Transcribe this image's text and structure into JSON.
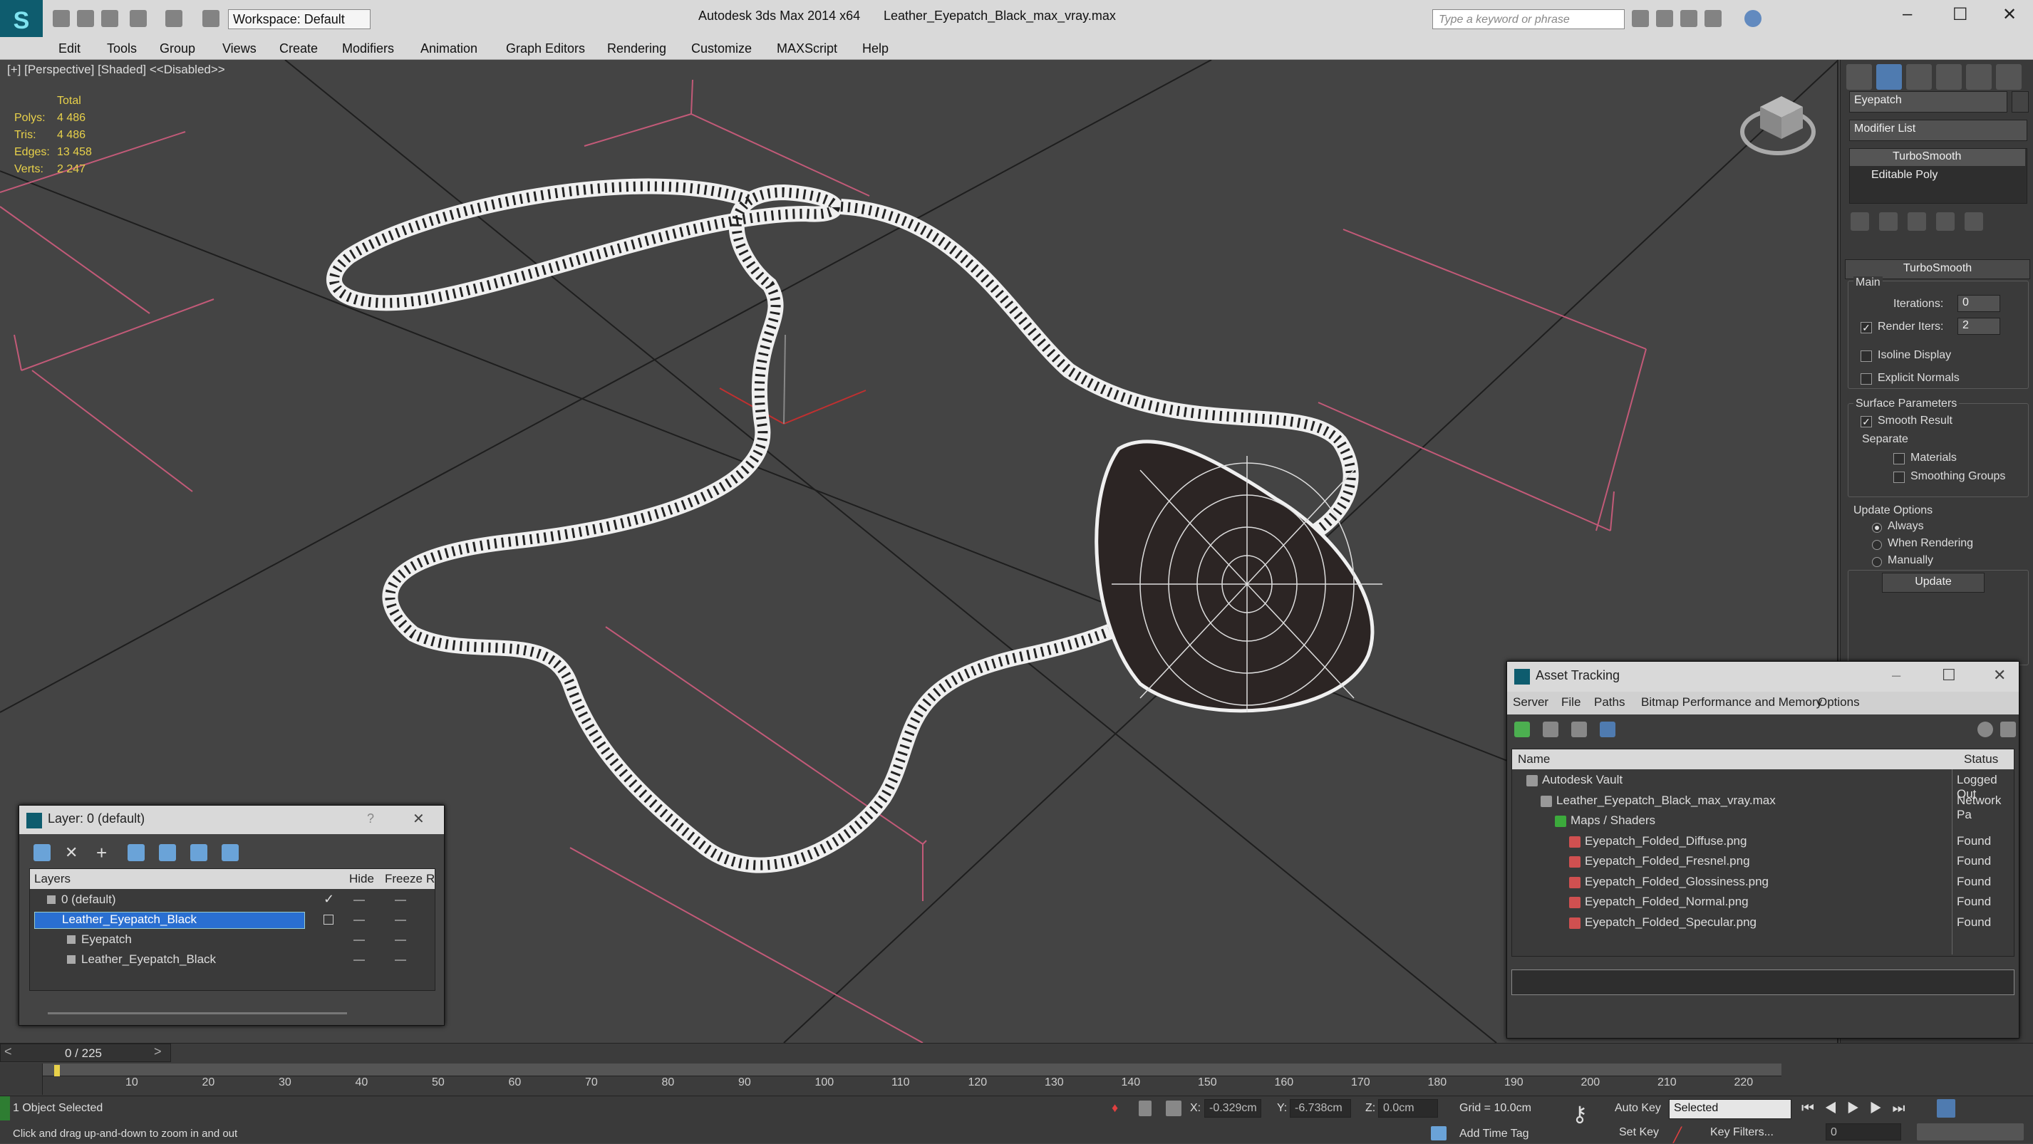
{
  "app": {
    "title": "Autodesk 3ds Max  2014 x64",
    "filename": "Leather_Eyepatch_Black_max_vray.max",
    "workspace": "Workspace: Default",
    "search_placeholder": "Type a keyword or phrase",
    "logo": "S"
  },
  "menu": [
    "Edit",
    "Tools",
    "Group",
    "Views",
    "Create",
    "Modifiers",
    "Animation",
    "Graph Editors",
    "Rendering",
    "Customize",
    "MAXScript",
    "Help"
  ],
  "viewport": {
    "label": "[+] [Perspective] [Shaded]  <<Disabled>>",
    "stats": {
      "header": "Total",
      "rows": [
        {
          "label": "Polys:",
          "value": "4 486"
        },
        {
          "label": "Tris:",
          "value": "4 486"
        },
        {
          "label": "Edges:",
          "value": "13 458"
        },
        {
          "label": "Verts:",
          "value": "2 247"
        }
      ]
    }
  },
  "command_panel": {
    "object_name": "Eyepatch",
    "modifier_list": "Modifier List",
    "stack": [
      "TurboSmooth",
      "Editable Poly"
    ],
    "rollout_title": "TurboSmooth",
    "main_label": "Main",
    "iterations_label": "Iterations:",
    "iterations_value": "0",
    "render_iters_label": "Render Iters:",
    "render_iters_value": "2",
    "isoline_label": "Isoline Display",
    "explicit_label": "Explicit Normals",
    "surface_label": "Surface Parameters",
    "smooth_label": "Smooth Result",
    "separate_label": "Separate",
    "materials_label": "Materials",
    "smoothing_groups_label": "Smoothing Groups",
    "update_options_label": "Update Options",
    "always_label": "Always",
    "when_rendering_label": "When Rendering",
    "manually_label": "Manually",
    "update_button": "Update"
  },
  "layer_dialog": {
    "title": "Layer: 0 (default)",
    "col_layers": "Layers",
    "col_hide": "Hide",
    "col_freeze": "Freeze",
    "col_extra": "R",
    "rows": [
      {
        "name": "0 (default)",
        "indent": 1,
        "selected": false
      },
      {
        "name": "Leather_Eyepatch_Black",
        "indent": 1,
        "selected": true
      },
      {
        "name": "Eyepatch",
        "indent": 2,
        "selected": false
      },
      {
        "name": "Leather_Eyepatch_Black",
        "indent": 2,
        "selected": false
      }
    ],
    "help": "?",
    "close": "✕"
  },
  "asset_tracking": {
    "title": "Asset Tracking",
    "menu": [
      "Server",
      "File",
      "Paths",
      "Bitmap Performance and Memory",
      "Options"
    ],
    "col_name": "Name",
    "col_status": "Status",
    "rows": [
      {
        "name": "Autodesk Vault",
        "status": "Logged Out",
        "indent": 1
      },
      {
        "name": "Leather_Eyepatch_Black_max_vray.max",
        "status": "Network Pa",
        "indent": 2
      },
      {
        "name": "Maps / Shaders",
        "status": "",
        "indent": 3
      },
      {
        "name": "Eyepatch_Folded_Diffuse.png",
        "status": "Found",
        "indent": 4
      },
      {
        "name": "Eyepatch_Folded_Fresnel.png",
        "status": "Found",
        "indent": 4
      },
      {
        "name": "Eyepatch_Folded_Glossiness.png",
        "status": "Found",
        "indent": 4
      },
      {
        "name": "Eyepatch_Folded_Normal.png",
        "status": "Found",
        "indent": 4
      },
      {
        "name": "Eyepatch_Folded_Specular.png",
        "status": "Found",
        "indent": 4
      }
    ]
  },
  "timeline": {
    "frame_counter": "0 / 225",
    "ticks": [
      "10",
      "20",
      "30",
      "40",
      "50",
      "60",
      "70",
      "80",
      "90",
      "100",
      "110",
      "120",
      "130",
      "140",
      "150",
      "160",
      "170",
      "180",
      "190",
      "200",
      "210",
      "220"
    ]
  },
  "status": {
    "selection": "1 Object Selected",
    "prompt": "Click and drag up-and-down to zoom in and out",
    "x_label": "X:",
    "x_value": "-0.329cm",
    "y_label": "Y:",
    "y_value": "-6.738cm",
    "z_label": "Z:",
    "z_value": "0.0cm",
    "grid": "Grid = 10.0cm",
    "auto_key": "Auto Key",
    "selected_dropdown": "Selected",
    "set_key": "Set Key",
    "key_filters": "Key Filters...",
    "add_time_tag": "Add Time Tag",
    "frame_value": "0"
  }
}
